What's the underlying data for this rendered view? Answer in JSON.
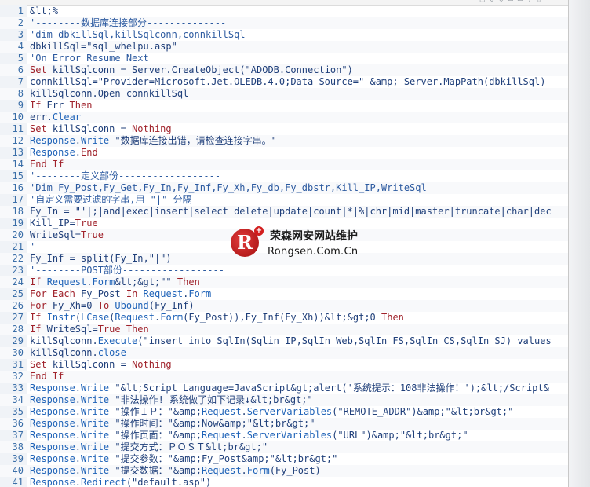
{
  "editor": {
    "toolbar_icons": [
      "□",
      "◇",
      "◇",
      "▭",
      "▭",
      "?",
      "▯"
    ],
    "lines": [
      {
        "n": "1",
        "html": "&amp;lt;%"
      },
      {
        "n": "2",
        "html": "'--------数据库连接部分--------------"
      },
      {
        "n": "3",
        "html": "'dim dbkillSql,killSqlconn,connkillSql"
      },
      {
        "n": "4",
        "html": "dbkillSql=\"sql_whelpu.asp\""
      },
      {
        "n": "5",
        "html": "'On Error Resume Next"
      },
      {
        "n": "6",
        "html": "Set killSqlconn = Server.CreateObject(\"ADODB.Connection\")"
      },
      {
        "n": "7",
        "html": "connkillSql=\"Provider=Microsoft.Jet.OLEDB.4.0;Data Source=\" &amp;amp; Server.MapPath(dbkillSql)"
      },
      {
        "n": "8",
        "html": "killSqlconn.Open connkillSql"
      },
      {
        "n": "9",
        "html": "If Err Then"
      },
      {
        "n": "10",
        "html": "err.Clear"
      },
      {
        "n": "11",
        "html": "Set killSqlconn = Nothing"
      },
      {
        "n": "12",
        "html": "Response.Write \"数据库连接出错，请检查连接字串。\""
      },
      {
        "n": "13",
        "html": "Response.End"
      },
      {
        "n": "14",
        "html": "End If"
      },
      {
        "n": "15",
        "html": "'--------定义部份------------------"
      },
      {
        "n": "16",
        "html": "'Dim Fy_Post,Fy_Get,Fy_In,Fy_Inf,Fy_Xh,Fy_db,Fy_dbstr,Kill_IP,WriteSql"
      },
      {
        "n": "17",
        "html": "'自定义需要过滤的字串,用 \"|\" 分隔"
      },
      {
        "n": "18",
        "html": "Fy_In = \"'|;|and|exec|insert|select|delete|update|count|*|%|chr|mid|master|truncate|char|dec"
      },
      {
        "n": "19",
        "html": "Kill_IP=True"
      },
      {
        "n": "20",
        "html": "WriteSql=True"
      },
      {
        "n": "21",
        "html": "'----------------------------------"
      },
      {
        "n": "22",
        "html": "Fy_Inf = split(Fy_In,\"|\")"
      },
      {
        "n": "23",
        "html": "'--------POST部份------------------"
      },
      {
        "n": "24",
        "html": "If Request.Form&amp;lt;&amp;gt;\"\" Then"
      },
      {
        "n": "25",
        "html": "For Each Fy_Post In Request.Form"
      },
      {
        "n": "26",
        "html": "For Fy_Xh=0 To Ubound(Fy_Inf)"
      },
      {
        "n": "27",
        "html": "If Instr(LCase(Request.Form(Fy_Post)),Fy_Inf(Fy_Xh))&amp;lt;&amp;gt;0 Then"
      },
      {
        "n": "28",
        "html": "If WriteSql=True Then"
      },
      {
        "n": "29",
        "html": "killSqlconn.Execute(\"insert into SqlIn(Sqlin_IP,SqlIn_Web,SqlIn_FS,SqlIn_CS,SqlIn_SJ) values"
      },
      {
        "n": "30",
        "html": "killSqlconn.close"
      },
      {
        "n": "31",
        "html": "Set killSqlconn = Nothing"
      },
      {
        "n": "32",
        "html": "End If"
      },
      {
        "n": "33",
        "html": "Response.Write \"&amp;lt;Script Language=JavaScript&amp;gt;alert('系统提示：108非法操作！');&amp;lt;/Script&amp;"
      },
      {
        "n": "34",
        "html": "Response.Write \"非法操作! 系统做了如下记录↓&amp;lt;br&amp;gt;\""
      },
      {
        "n": "35",
        "html": "Response.Write \"操作ＩＰ：\"&amp;amp;Request.ServerVariables(\"REMOTE_ADDR\")&amp;amp;\"&amp;lt;br&amp;gt;\""
      },
      {
        "n": "36",
        "html": "Response.Write \"操作时间：\"&amp;amp;Now&amp;amp;\"&amp;lt;br&amp;gt;\""
      },
      {
        "n": "37",
        "html": "Response.Write \"操作页面：\"&amp;amp;Request.ServerVariables(\"URL\")&amp;amp;\"&amp;lt;br&amp;gt;\""
      },
      {
        "n": "38",
        "html": "Response.Write \"提交方式：ＰＯＳＴ&amp;lt;br&amp;gt;\""
      },
      {
        "n": "39",
        "html": "Response.Write \"提交参数：\"&amp;amp;Fy_Post&amp;amp;\"&amp;lt;br&amp;gt;\""
      },
      {
        "n": "40",
        "html": "Response.Write \"提交数据：\"&amp;amp;Request.Form(Fy_Post)"
      },
      {
        "n": "41",
        "html": "Response.Redirect(\"default.asp\")"
      }
    ]
  },
  "watermark": {
    "badge_letter": "R",
    "plus": "+",
    "cn": "荣森网安网站维护",
    "en": "Rongsen.Com.Cn"
  }
}
